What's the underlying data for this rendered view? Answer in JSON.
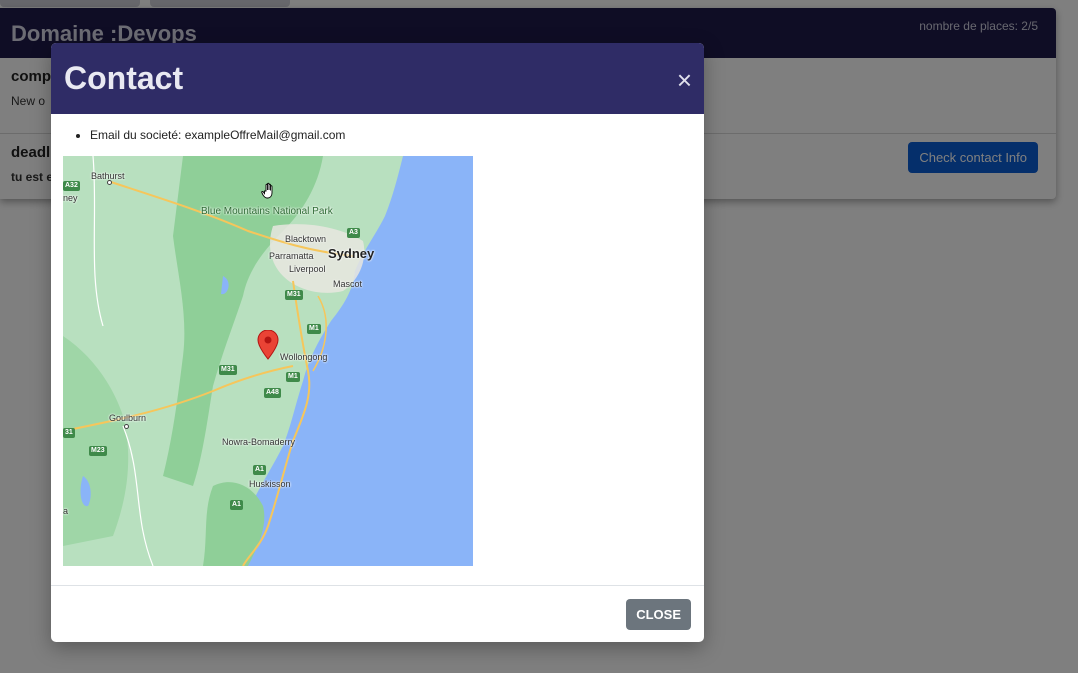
{
  "card": {
    "title": "Domaine :Devops",
    "places": "nombre de places: 2/5",
    "section1_heading": "comp",
    "section1_text": "New o",
    "section2_heading": "deadl",
    "section2_text": "tu est e",
    "check_button": "Check contact Info"
  },
  "modal": {
    "title": "Contact",
    "close_x": "×",
    "email_line": "Email du societé: exampleOffreMail@gmail.com",
    "close_button": "CLOSE"
  },
  "map": {
    "places": {
      "bathurst": "Bathurst",
      "blue_mountains": "Blue Mountains National Park",
      "blacktown": "Blacktown",
      "sydney": "Sydney",
      "parramatta": "Parramatta",
      "liverpool": "Liverpool",
      "mascot": "Mascot",
      "wollongong": "Wollongong",
      "goulburn": "Goulburn",
      "nowra": "Nowra-Bomaderry",
      "huskisson": "Huskisson",
      "edge_top": "ney",
      "edge_bottom": "a"
    },
    "shields": [
      "A32",
      "A3",
      "M31",
      "M1",
      "M31",
      "M1",
      "A48",
      "31",
      "M23",
      "A1",
      "A1"
    ],
    "colors": {
      "ocean": "#8ab4f8",
      "land": "#b8e0bf",
      "forest": "#8fcf98",
      "road": "#f6c65b",
      "pin": "#ea4335"
    }
  }
}
